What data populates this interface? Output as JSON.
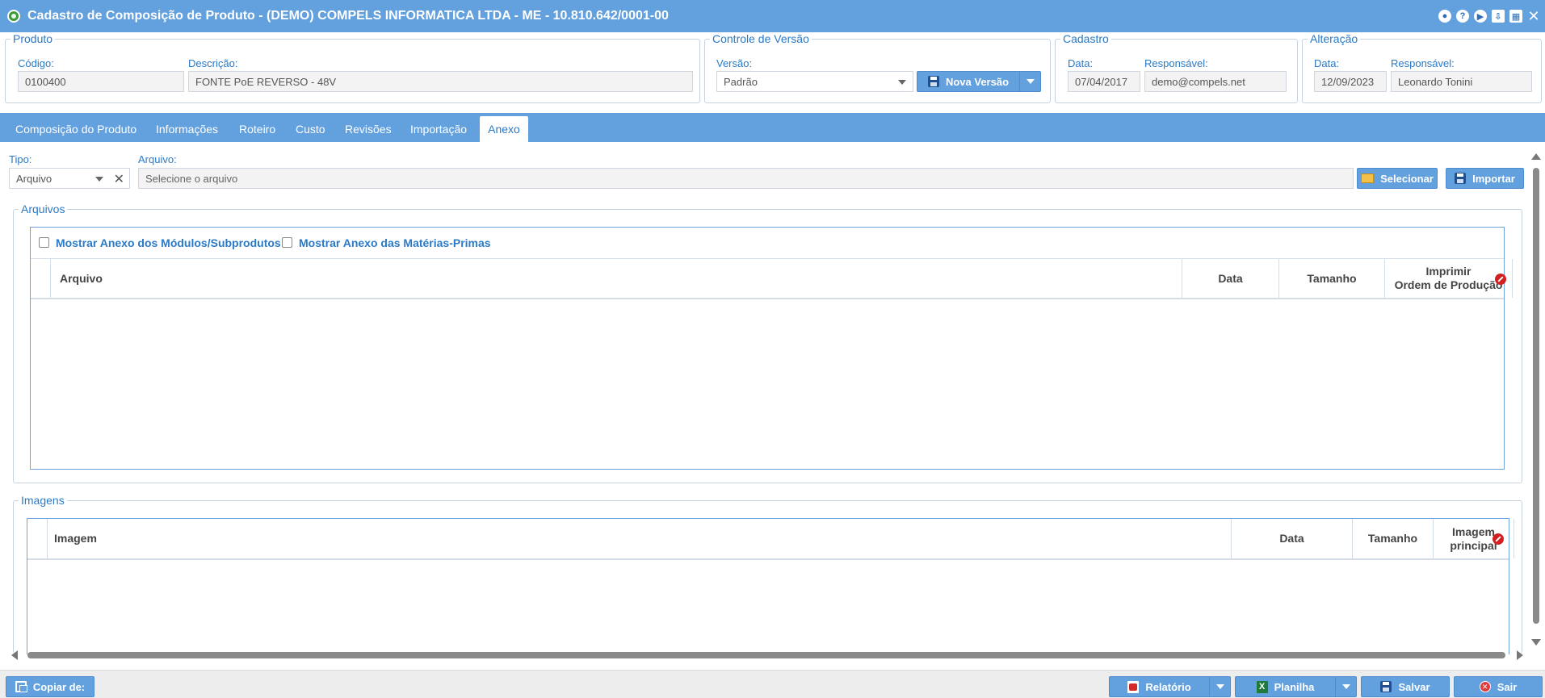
{
  "window": {
    "title": "Cadastro de Composição de Produto - (DEMO) COMPELS INFORMATICA LTDA - ME - 10.810.642/0001-00",
    "icons": [
      "settings-icon",
      "help-icon",
      "play-icon",
      "pin-icon",
      "calendar-icon",
      "close-icon"
    ]
  },
  "produto": {
    "legend": "Produto",
    "codigo_label": "Código:",
    "codigo_value": "0100400",
    "descricao_label": "Descrição:",
    "descricao_value": "FONTE PoE REVERSO - 48V"
  },
  "versao": {
    "legend": "Controle de Versão",
    "versao_label": "Versão:",
    "versao_value": "Padrão",
    "nova_versao_label": "Nova Versão"
  },
  "cadastro": {
    "legend": "Cadastro",
    "data_label": "Data:",
    "data_value": "07/04/2017",
    "responsavel_label": "Responsável:",
    "responsavel_value": "demo@compels.net"
  },
  "alteracao": {
    "legend": "Alteração",
    "data_label": "Data:",
    "data_value": "12/09/2023",
    "responsavel_label": "Responsável:",
    "responsavel_value": "Leonardo Tonini"
  },
  "tabs": [
    {
      "label": "Composição do Produto"
    },
    {
      "label": "Informações"
    },
    {
      "label": "Roteiro"
    },
    {
      "label": "Custo"
    },
    {
      "label": "Revisões"
    },
    {
      "label": "Importação"
    },
    {
      "label": "Anexo",
      "active": true
    }
  ],
  "anexo": {
    "tipo_label": "Tipo:",
    "tipo_value": "Arquivo",
    "arquivo_label": "Arquivo:",
    "arquivo_placeholder": "Selecione o arquivo",
    "selecionar_label": "Selecionar",
    "importar_label": "Importar"
  },
  "arquivos": {
    "legend": "Arquivos",
    "chk_modulos_label": "Mostrar Anexo dos Módulos/Subprodutos",
    "chk_materias_label": "Mostrar Anexo das Matérias-Primas",
    "columns": {
      "arquivo": "Arquivo",
      "data": "Data",
      "tamanho": "Tamanho",
      "imprimir_1": "Imprimir",
      "imprimir_2": "Ordem de Produção"
    },
    "rows": []
  },
  "imagens": {
    "legend": "Imagens",
    "columns": {
      "imagem": "Imagem",
      "data": "Data",
      "tamanho": "Tamanho",
      "principal_1": "Imagem",
      "principal_2": "principal"
    },
    "rows": []
  },
  "footer": {
    "copiar_label": "Copiar de:",
    "relatorio_label": "Relatório",
    "planilha_label": "Planilha",
    "salvar_label": "Salvar",
    "sair_label": "Sair"
  }
}
